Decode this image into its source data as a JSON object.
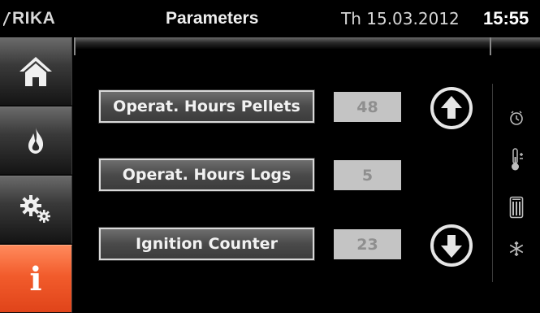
{
  "header": {
    "logo": "RIKA",
    "title": "Parameters",
    "date": "Th 15.03.2012",
    "time": "15:55"
  },
  "sidebar": {
    "items": [
      {
        "icon": "home-icon",
        "active": false
      },
      {
        "icon": "flame-icon",
        "active": false
      },
      {
        "icon": "settings-gears-icon",
        "active": false
      },
      {
        "icon": "info-icon",
        "label": "i",
        "active": true
      }
    ]
  },
  "parameters": [
    {
      "label": "Operat. Hours Pellets",
      "value": "48"
    },
    {
      "label": "Operat. Hours Logs",
      "value": "5"
    },
    {
      "label": "Ignition Counter",
      "value": "23"
    }
  ],
  "navigation": {
    "up": "arrow-up-icon",
    "down": "arrow-down-icon"
  },
  "right_icons": [
    "clock-icon",
    "thermometer-icon",
    "fuel-tank-icon",
    "snowflake-icon"
  ],
  "colors": {
    "accent": "#f25c2c",
    "value_bg": "#c4c4c4",
    "value_text": "#8f8f8f"
  }
}
